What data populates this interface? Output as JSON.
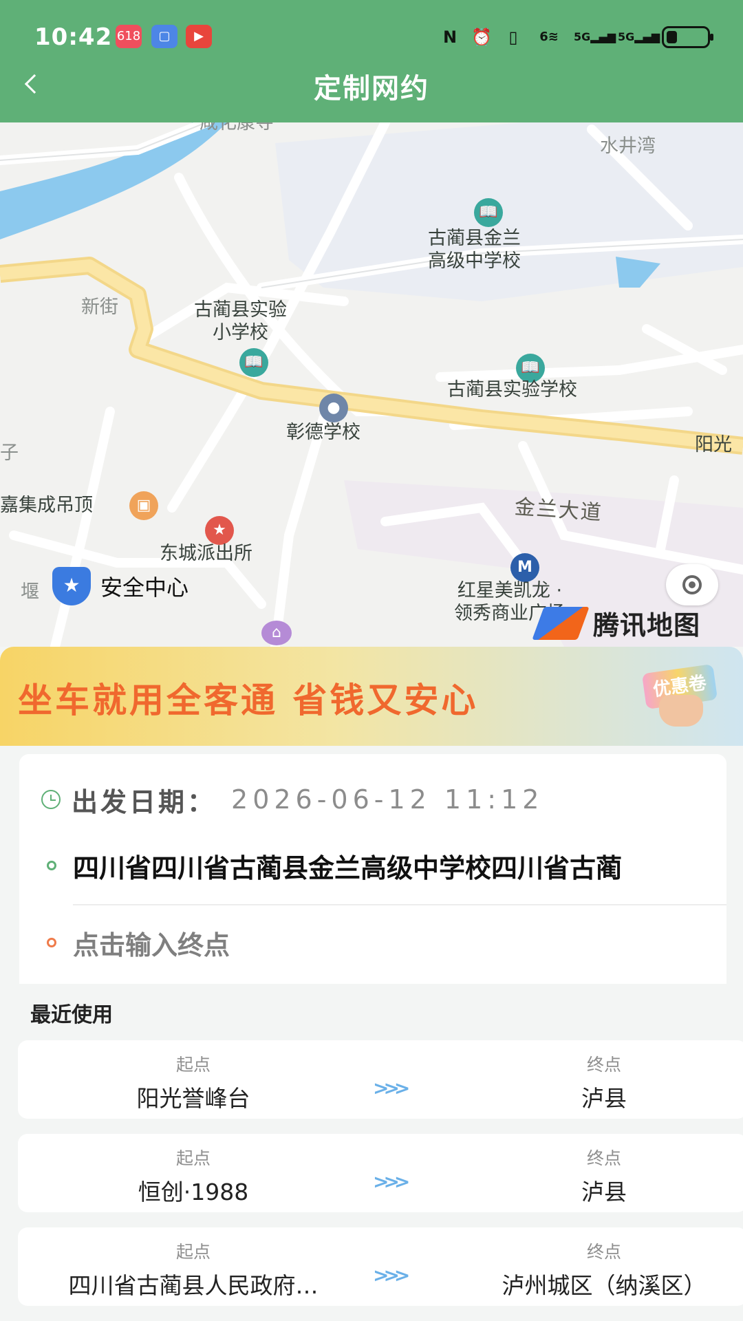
{
  "status_bar": {
    "time": "10:42",
    "notification_icons": [
      "618-app-icon",
      "app-icon",
      "video-icon"
    ],
    "notification_badge": "618",
    "system_icons": [
      "nfc-icon",
      "alarm-icon",
      "vibrate-icon",
      "wifi-icon",
      "signal-5g-icon",
      "signal-5g-icon",
      "battery-icon"
    ],
    "signal_labels": [
      "6",
      "5G",
      "5G"
    ],
    "battery_level": 0.25
  },
  "header": {
    "title": "定制网约",
    "accent_color": "#5fb077"
  },
  "map": {
    "pois": [
      {
        "id": "jinlan-high",
        "text_line1": "古蔺县金兰",
        "text_line2": "高级中学校",
        "icon": "school-icon"
      },
      {
        "id": "exp-primary",
        "text_line1": "古蔺县实验",
        "text_line2": "小学校",
        "icon": "school-icon"
      },
      {
        "id": "exp-school",
        "text_line1": "古蔺县实验学校",
        "icon": "school-icon"
      },
      {
        "id": "zhangde",
        "text_line1": "彰德学校",
        "icon": "location-pin-icon"
      },
      {
        "id": "dongcheng",
        "text_line1": "东城派出所",
        "icon": "police-icon"
      },
      {
        "id": "jiajia",
        "text_line1": "嘉集成吊顶",
        "icon": "shopping-bag-icon"
      },
      {
        "id": "hongxing",
        "text_line1": "红星美凯龙 ·",
        "text_line2": "领秀商业广场",
        "icon": "metro-icon"
      }
    ],
    "area_labels": {
      "shuijingwan": "水井湾",
      "xinjie": "新街",
      "yangguang": "阳光",
      "yan": "堰",
      "zi": "子",
      "top_cut": "咸化康寺"
    },
    "road_label": "金兰大道",
    "safety_center": "安全中心",
    "provider": "腾讯地图"
  },
  "banner": {
    "slogan": "坐车就用全客通 省钱又安心",
    "coupon_label": "优惠卷"
  },
  "form": {
    "date_label": "出发日期：",
    "date_value": "2026-06-12 11:12",
    "from_value": "四川省四川省古蔺县金兰高级中学校四川省古蔺",
    "to_placeholder": "点击输入终点"
  },
  "recent": {
    "title": "最近使用",
    "start_caption": "起点",
    "end_caption": "终点",
    "trips": [
      {
        "start": "阳光誉峰台",
        "end": "泸县"
      },
      {
        "start": "恒创·1988",
        "end": "泸县"
      },
      {
        "start": "四川省古蔺县人民政府…",
        "end": "泸州城区（纳溪区）"
      }
    ]
  }
}
